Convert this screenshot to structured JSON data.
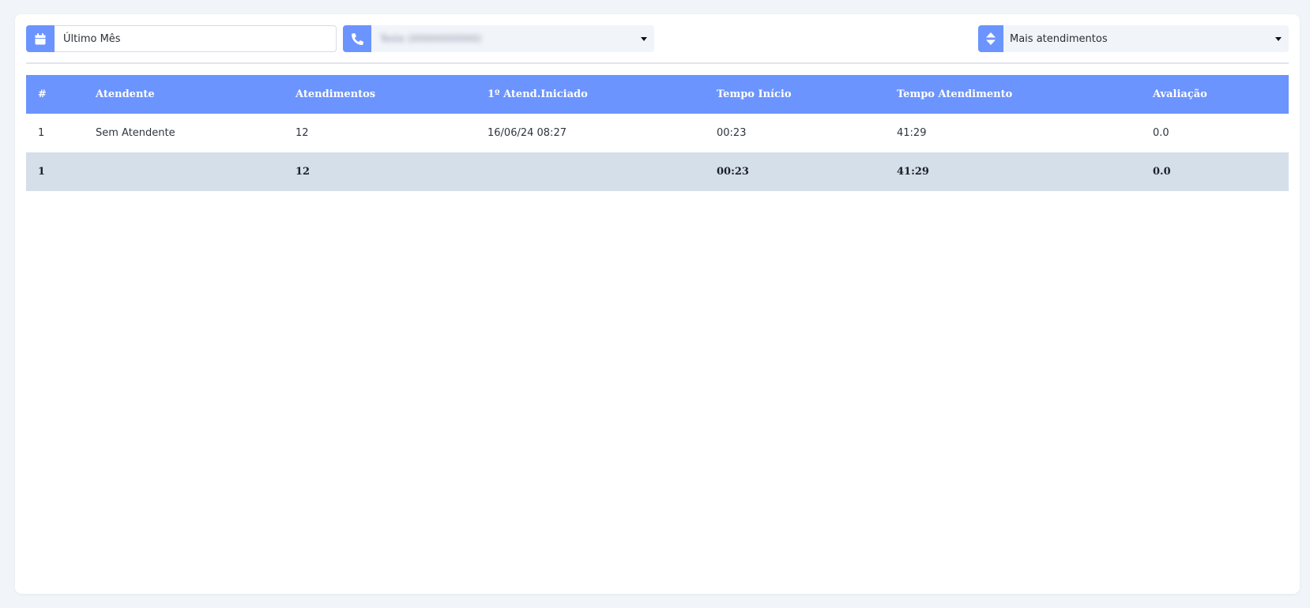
{
  "filters": {
    "date_range": {
      "value": "Último Mês",
      "icon": "calendar-icon"
    },
    "phone": {
      "value": "Teste (00000000000)",
      "icon": "phone-icon"
    },
    "sort": {
      "value": "Mais atendimentos",
      "icon": "sort-icon"
    }
  },
  "table": {
    "headers": [
      "#",
      "Atendente",
      "Atendimentos",
      "1º Atend.Iniciado",
      "Tempo Início",
      "Tempo Atendimento",
      "Avaliação"
    ],
    "rows": [
      [
        "1",
        "Sem Atendente",
        "12",
        "16/06/24 08:27",
        "00:23",
        "41:29",
        "0.0"
      ]
    ],
    "totals": [
      "1",
      "",
      "12",
      "",
      "00:23",
      "41:29",
      "0.0"
    ]
  },
  "colors": {
    "accent": "#6b94fe",
    "total_row": "#d5dfe9",
    "background": "#f1f4f9"
  }
}
